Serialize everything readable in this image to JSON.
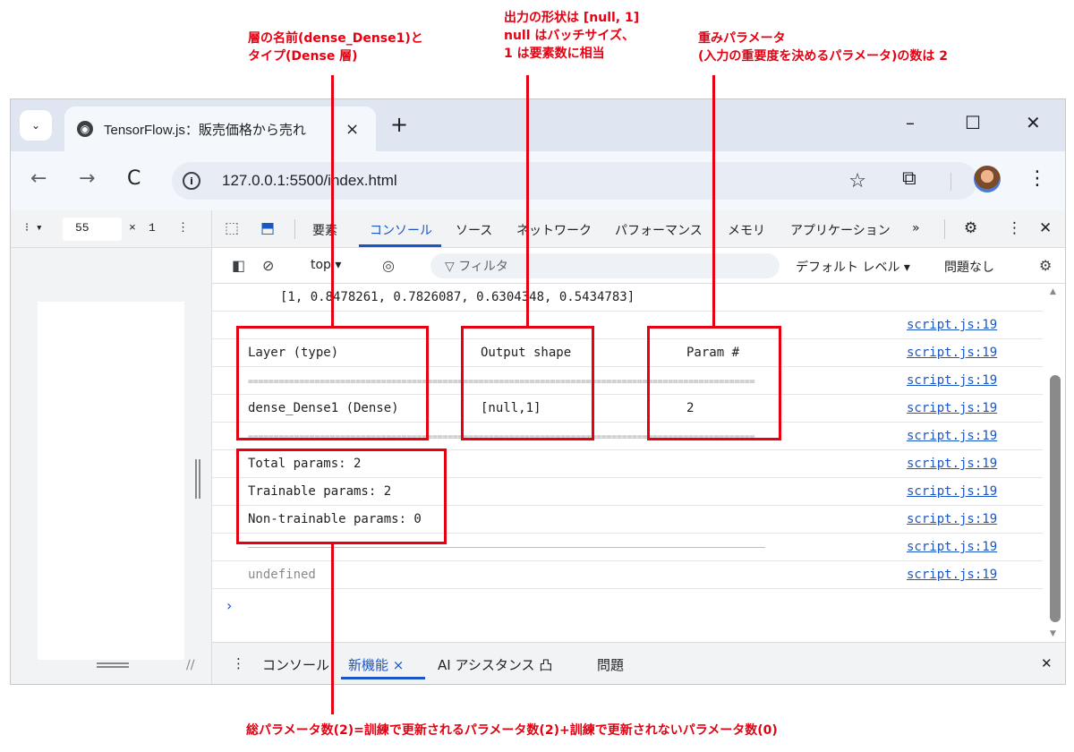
{
  "annotations": {
    "layer_name": [
      "層の名前(dense_Dense1)と",
      "タイプ(Dense 層)"
    ],
    "output_shape": [
      "出力の形状は [null, 1]",
      "null はバッチサイズ、",
      "1 は要素数に相当"
    ],
    "params": [
      "重みパラメータ",
      "(入力の重要度を決めるパラメータ)の数は 2"
    ],
    "bottom": "総パラメータ数(2)=訓練で更新されるパラメータ数(2)+訓練で更新されないパラメータ数(0)",
    "color": "#e60012"
  },
  "browser": {
    "tab_title": "TensorFlow.js：販売価格から売れ",
    "tab_close": "×",
    "new_tab": "+",
    "menu_icon": "⌄",
    "minimize": "–",
    "maximize": "☐",
    "close": "✕",
    "back": "←",
    "forward": "→",
    "reload": "C",
    "url": "127.0.0.1:5500/index.html",
    "star": "☆",
    "extensions": "⧉",
    "kebab": "⋮"
  },
  "page_toolbar": {
    "device": "⁝ ▾",
    "width": "55",
    "times": "×",
    "height": "1",
    "more": "⋮"
  },
  "devtools": {
    "tabs": [
      "要素",
      "コンソール",
      "ソース",
      "ネットワーク",
      "パフォーマンス",
      "メモリ",
      "アプリケーション",
      "»"
    ],
    "inspect_icon": "⬚",
    "device_icon": "⬒",
    "settings_icon": "⚙",
    "more_icon": "⋮",
    "close_icon": "✕",
    "accent": "#1a56c4"
  },
  "console_toolbar": {
    "sidebar_icon": "◧",
    "clear_icon": "⊘",
    "context": "top ▾",
    "eye_icon": "◎",
    "filter_placeholder": "▽ フィルタ",
    "levels": "デフォルト レベル ▾",
    "issues": "問題なし",
    "settings": "⚙"
  },
  "console": {
    "array_line": "[1, 0.8478261, 0.7826087, 0.6304348, 0.5434783]",
    "src": "script.js:19",
    "header": {
      "layer": "Layer (type)",
      "shape": "Output shape",
      "param": "Param #"
    },
    "eq_rule": "===================================================================================================",
    "row": {
      "layer": "dense_Dense1 (Dense)",
      "shape": "[null,1]",
      "param": "2"
    },
    "total": "Total params: 2",
    "trainable": "Trainable params: 2",
    "non_trainable": "Non-trainable params: 0",
    "undefined": "undefined",
    "prompt": "›"
  },
  "drawer": {
    "more": "⋮",
    "console": "コンソール",
    "whatsnew": "新機能 ×",
    "ai": "AI アシスタンス 凸",
    "issues": "問題",
    "close": "✕"
  }
}
